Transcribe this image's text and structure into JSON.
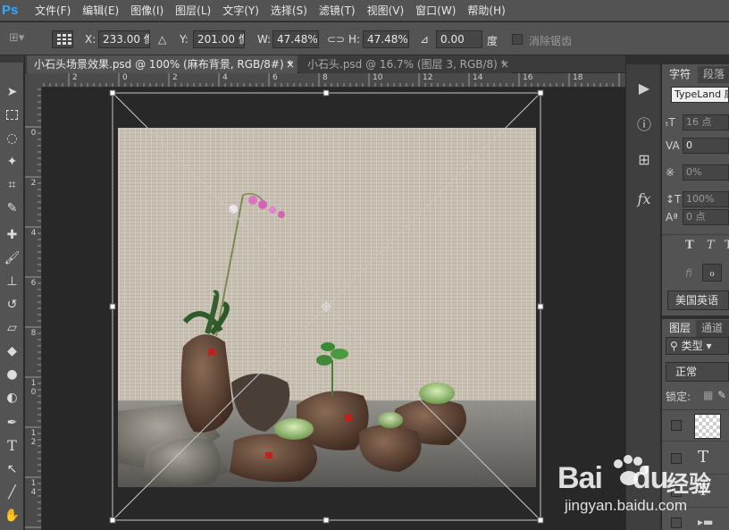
{
  "app": {
    "logo": "Ps"
  },
  "menu": [
    "文件(F)",
    "编辑(E)",
    "图像(I)",
    "图层(L)",
    "文字(Y)",
    "选择(S)",
    "滤镜(T)",
    "视图(V)",
    "窗口(W)",
    "帮助(H)"
  ],
  "options": {
    "x_label": "X:",
    "x_value": "233.00 像素",
    "y_label": "Y:",
    "y_value": "201.00 像素",
    "w_label": "W:",
    "w_value": "47.48%",
    "h_label": "H:",
    "h_value": "47.48%",
    "angle_value": "0.00",
    "angle_unit": "度",
    "antialias_label": "消除锯齿"
  },
  "tabs": [
    {
      "label": "小石头场景效果.psd @ 100% (麻布背景, RGB/8#) *",
      "close": "×",
      "active": true
    },
    {
      "label": "小石头.psd @ 16.7% (图层 3, RGB/8) *",
      "close": "×",
      "active": false
    }
  ],
  "ruler_top": [
    "2",
    "0",
    "2",
    "4",
    "6",
    "8",
    "10",
    "12",
    "14",
    "16",
    "18"
  ],
  "ruler_left": [
    "0",
    "2",
    "4",
    "6",
    "8",
    "1 0",
    "1 2",
    "1 4"
  ],
  "character_panel": {
    "tab_char": "字符",
    "tab_para": "段落",
    "font": "TypeLand 康",
    "size": "16 点",
    "kerning": "0",
    "tracking": "0%",
    "scale": "100%",
    "baseline": "0 点",
    "language": "美国英语"
  },
  "layers_panel": {
    "tab_layers": "图层",
    "tab_channels": "通道",
    "kind": "类型",
    "blend": "正常",
    "lock_label": "锁定:"
  },
  "watermark": {
    "brand": "Bai",
    "brand2": "du",
    "cn": "经验",
    "url": "jingyan.baidu.com"
  },
  "colors": {
    "accent": "#31a8ff",
    "chrome": "#535353",
    "canvas_bg": "#282828"
  }
}
